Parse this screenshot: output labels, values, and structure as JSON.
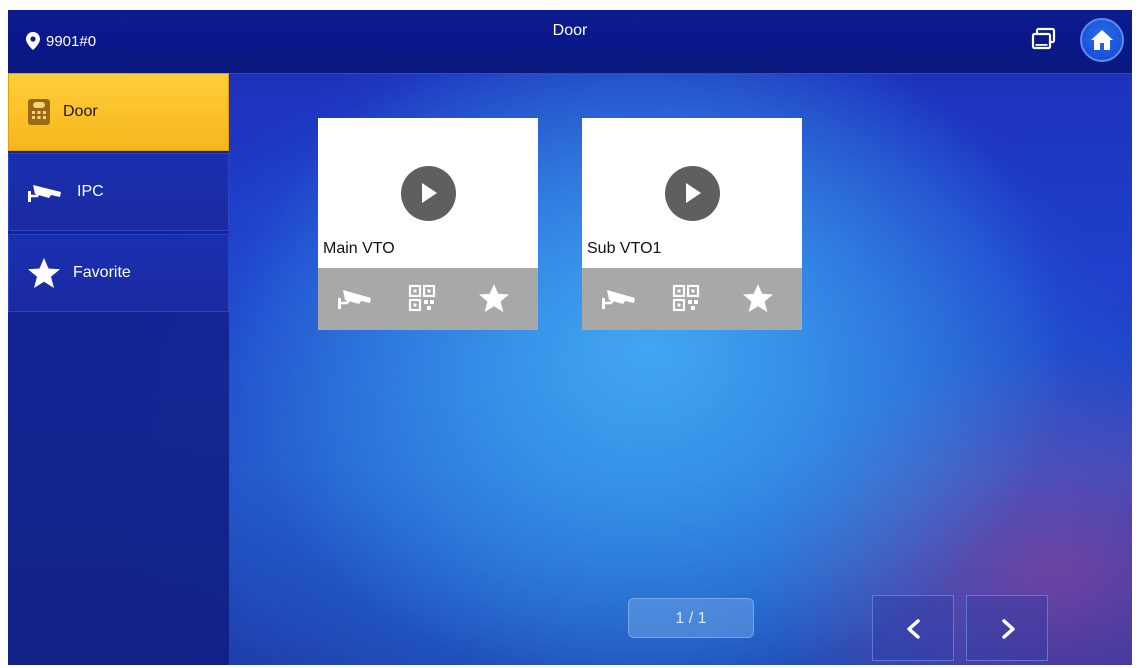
{
  "header": {
    "title": "Door",
    "location": "9901#0",
    "location_icon": "map-pin-icon",
    "monitor_icon": "monitor-icon",
    "home_icon": "home-icon"
  },
  "sidebar": {
    "items": [
      {
        "label": "Door",
        "icon": "door-station-icon",
        "active": true
      },
      {
        "label": "IPC",
        "icon": "camera-icon",
        "active": false
      },
      {
        "label": "Favorite",
        "icon": "star-icon",
        "active": false
      }
    ]
  },
  "cards": [
    {
      "name": "Main VTO",
      "actions": [
        "camera-icon",
        "qr-code-icon",
        "star-icon"
      ]
    },
    {
      "name": "Sub VTO1",
      "actions": [
        "camera-icon",
        "qr-code-icon",
        "star-icon"
      ]
    }
  ],
  "pager": {
    "label": "1 / 1"
  },
  "colors": {
    "accent": "#f7b51c",
    "background": "#1f3fcc"
  }
}
